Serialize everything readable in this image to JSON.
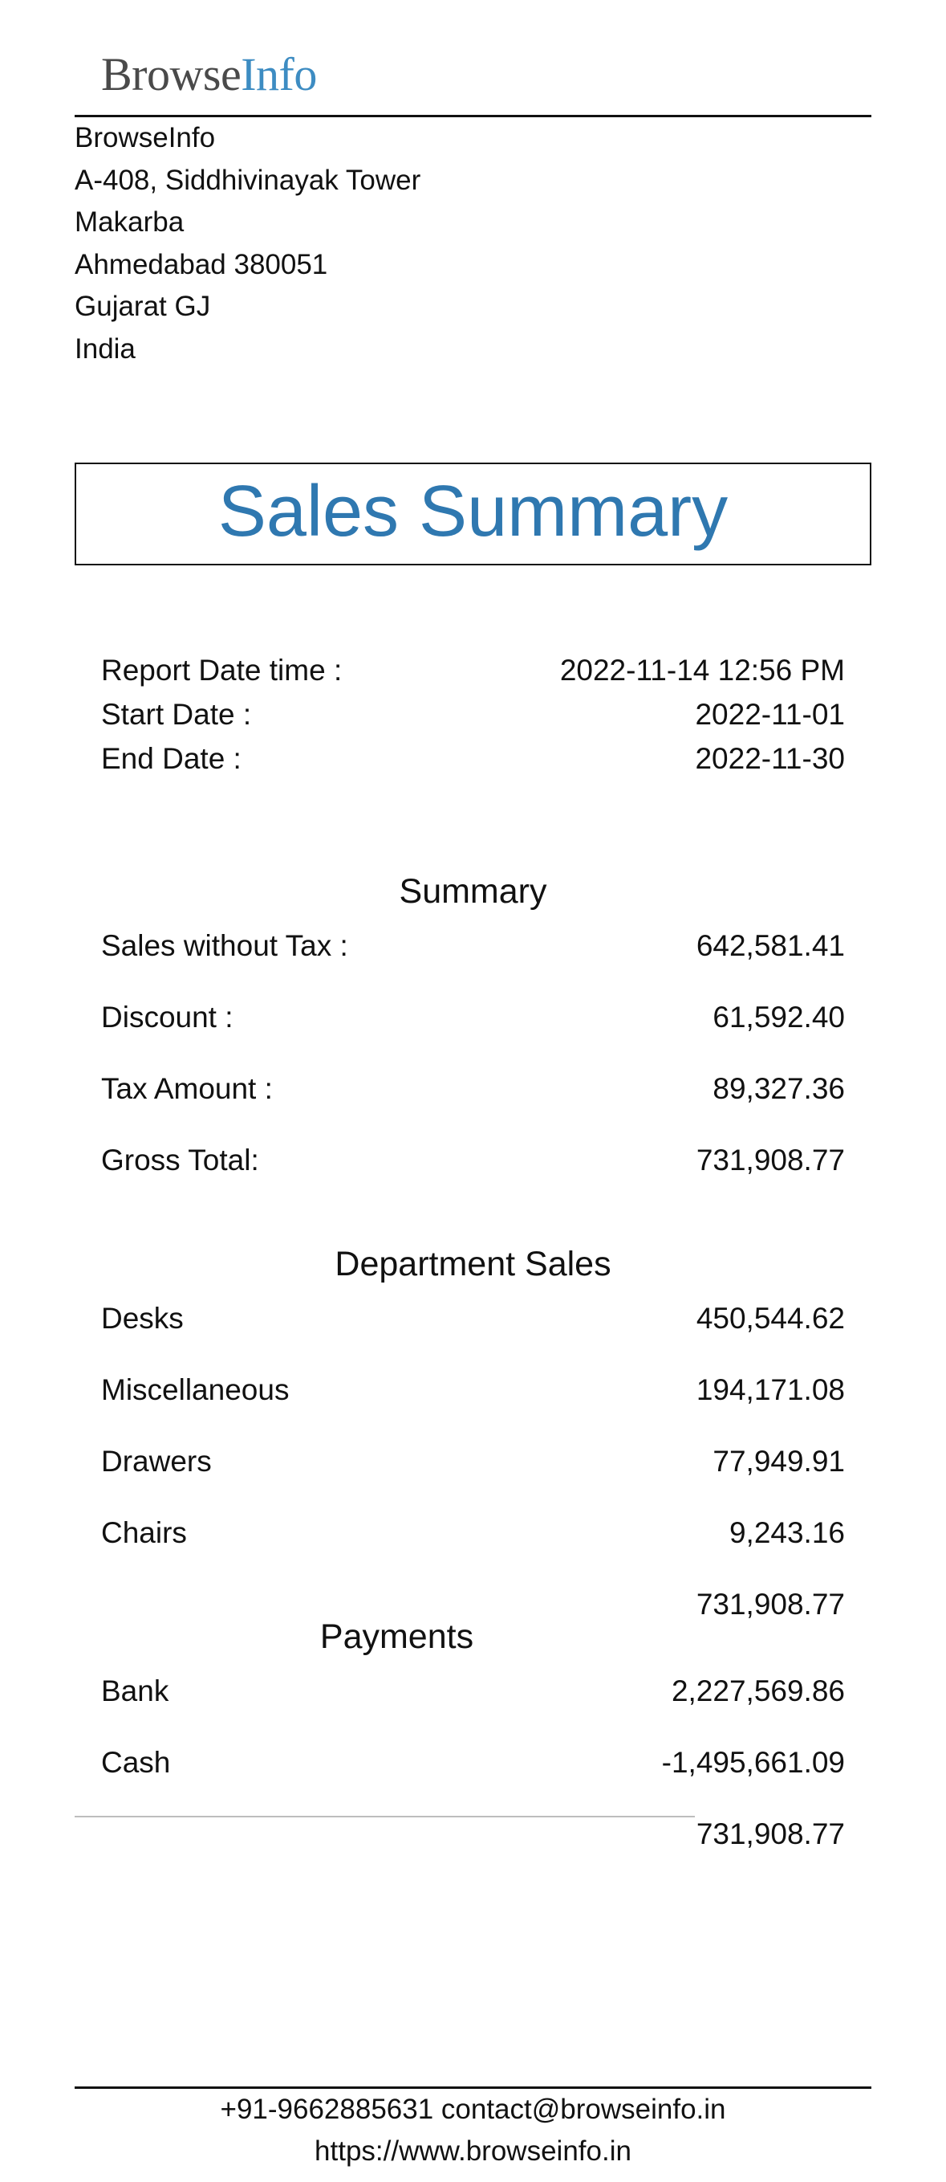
{
  "logo": {
    "part1": "Browse",
    "part2": "Info"
  },
  "company_address": [
    "BrowseInfo",
    "A-408, Siddhivinayak Tower",
    "Makarba",
    "Ahmedabad 380051",
    "Gujarat GJ",
    "India"
  ],
  "title": "Sales Summary",
  "report_info": [
    {
      "label": "Report Date time :",
      "value": "2022-11-14 12:56 PM"
    },
    {
      "label": "Start Date :",
      "value": "2022-11-01"
    },
    {
      "label": "End Date :",
      "value": "2022-11-30"
    }
  ],
  "summary": {
    "heading": "Summary",
    "rows": [
      {
        "label": "Sales without Tax :",
        "value": "642,581.41"
      },
      {
        "label": "Discount :",
        "value": "61,592.40"
      },
      {
        "label": "Tax Amount :",
        "value": "89,327.36"
      },
      {
        "label": "Gross Total:",
        "value": "731,908.77"
      }
    ]
  },
  "department_sales": {
    "heading": "Department Sales",
    "rows": [
      {
        "label": "Desks",
        "value": "450,544.62"
      },
      {
        "label": "Miscellaneous",
        "value": "194,171.08"
      },
      {
        "label": "Drawers",
        "value": "77,949.91"
      },
      {
        "label": "Chairs",
        "value": "9,243.16"
      }
    ],
    "total": "731,908.77"
  },
  "payments": {
    "heading": "Payments",
    "rows": [
      {
        "label": "Bank",
        "value": "2,227,569.86"
      },
      {
        "label": "Cash",
        "value": "-1,495,661.09"
      }
    ],
    "total": "731,908.77"
  },
  "footer": {
    "contact": "+91-9662885631 contact@browseinfo.in",
    "website": "https://www.browseinfo.in"
  }
}
